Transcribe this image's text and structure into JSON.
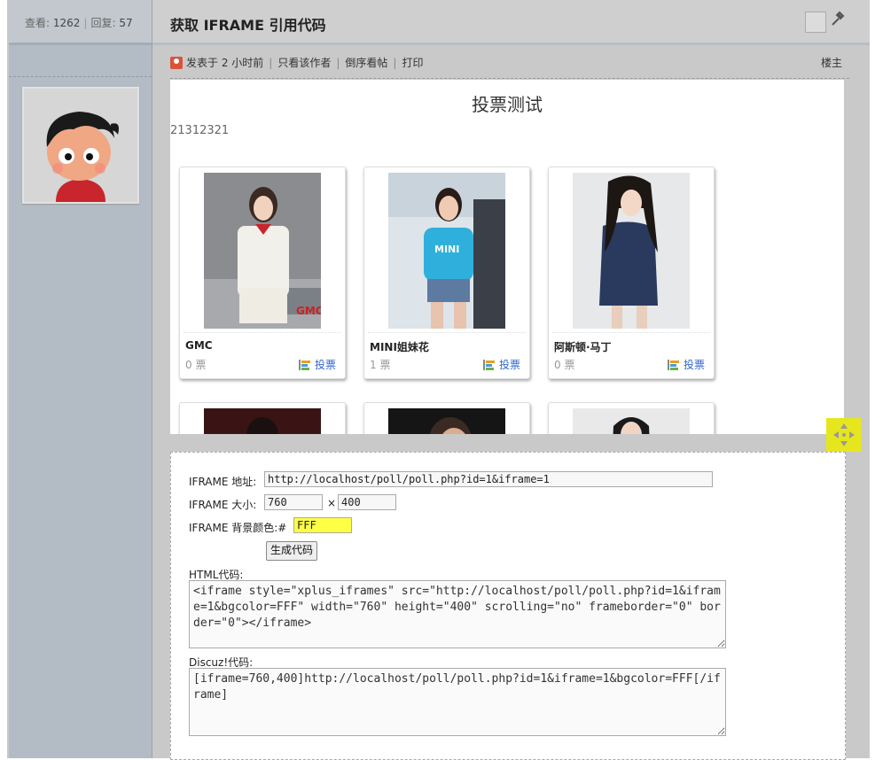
{
  "sidebar": {
    "views_label": "查看:",
    "views_count": "1262",
    "replies_label": "回复:",
    "replies_count": "57"
  },
  "thread": {
    "title": "获取 IFRAME 引用代码",
    "posted": "发表于 2 小时前",
    "only_author": "只看该作者",
    "reverse": "倒序看帖",
    "print": "打印",
    "floor": "楼主"
  },
  "poll": {
    "title": "投票测试",
    "description": "21312321",
    "vote_label": "投票",
    "items": [
      {
        "name": "GMC",
        "votes": "0 票"
      },
      {
        "name": "MINI姐妹花",
        "votes": "1 票"
      },
      {
        "name": "阿斯顿·马丁",
        "votes": "0 票"
      }
    ]
  },
  "generator": {
    "url_label": "IFRAME 地址:",
    "url_value": "http://localhost/poll/poll.php?id=1&iframe=1",
    "size_label": "IFRAME 大小:",
    "width_value": "760",
    "times": "×",
    "height_value": "400",
    "bg_label": "IFRAME 背景颜色:#",
    "bg_value": "FFF",
    "generate_button": "生成代码",
    "html_label": "HTML代码:",
    "html_code": "<iframe style=\"xplus_iframes\" src=\"http://localhost/poll/poll.php?id=1&iframe=1&bgcolor=FFF\" width=\"760\" height=\"400\" scrolling=\"no\" frameborder=\"0\" border=\"0\"></iframe>",
    "discuz_label": "Discuz!代码:",
    "discuz_code": "[iframe=760,400]http://localhost/poll/poll.php?id=1&iframe=1&bgcolor=FFF[/iframe]"
  },
  "colors": {
    "bg_highlight": "#ffff44",
    "resize_handle": "#e6e61e",
    "link": "#3366cc"
  }
}
